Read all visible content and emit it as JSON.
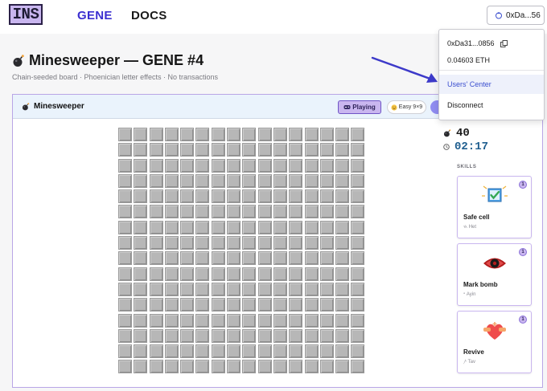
{
  "header": {
    "logo": "INS",
    "nav": [
      {
        "label": "GENE",
        "active": true
      },
      {
        "label": "DOCS",
        "active": false
      }
    ],
    "wallet_button": "0xDa...56",
    "active_color": "#3b2fd0"
  },
  "page": {
    "title": "Minesweeper — GENE #4",
    "subtitle": "Chain-seeded board · Phoenician letter effects · No transactions"
  },
  "game": {
    "title": "Minesweeper",
    "status": "Playing",
    "difficulty": "Easy 9×9",
    "board_rows": 16,
    "board_cols": 16,
    "mines_left": "40",
    "timer": "02:17",
    "skills_heading": "SKILLS",
    "skills": [
      {
        "name": "Safe cell",
        "letter": "𐤇 Het",
        "count": "1",
        "icon": "check-box-icon"
      },
      {
        "name": "Mark bomb",
        "letter": "𐤏 Ayin",
        "count": "1",
        "icon": "eye-icon"
      },
      {
        "name": "Revive",
        "letter": "𐤕 Tav",
        "count": "1",
        "icon": "heart-icon"
      }
    ]
  },
  "dropdown": {
    "address": "0xDa31...0856",
    "balance": "0.04603 ETH",
    "items": [
      "Users' Center",
      "Disconnect"
    ]
  },
  "colors": {
    "accent_purple": "#c9b6ef",
    "link_blue": "#3b4fcf",
    "timer_blue": "#1f5e8f",
    "cell_gray": "#b7b7b7"
  }
}
